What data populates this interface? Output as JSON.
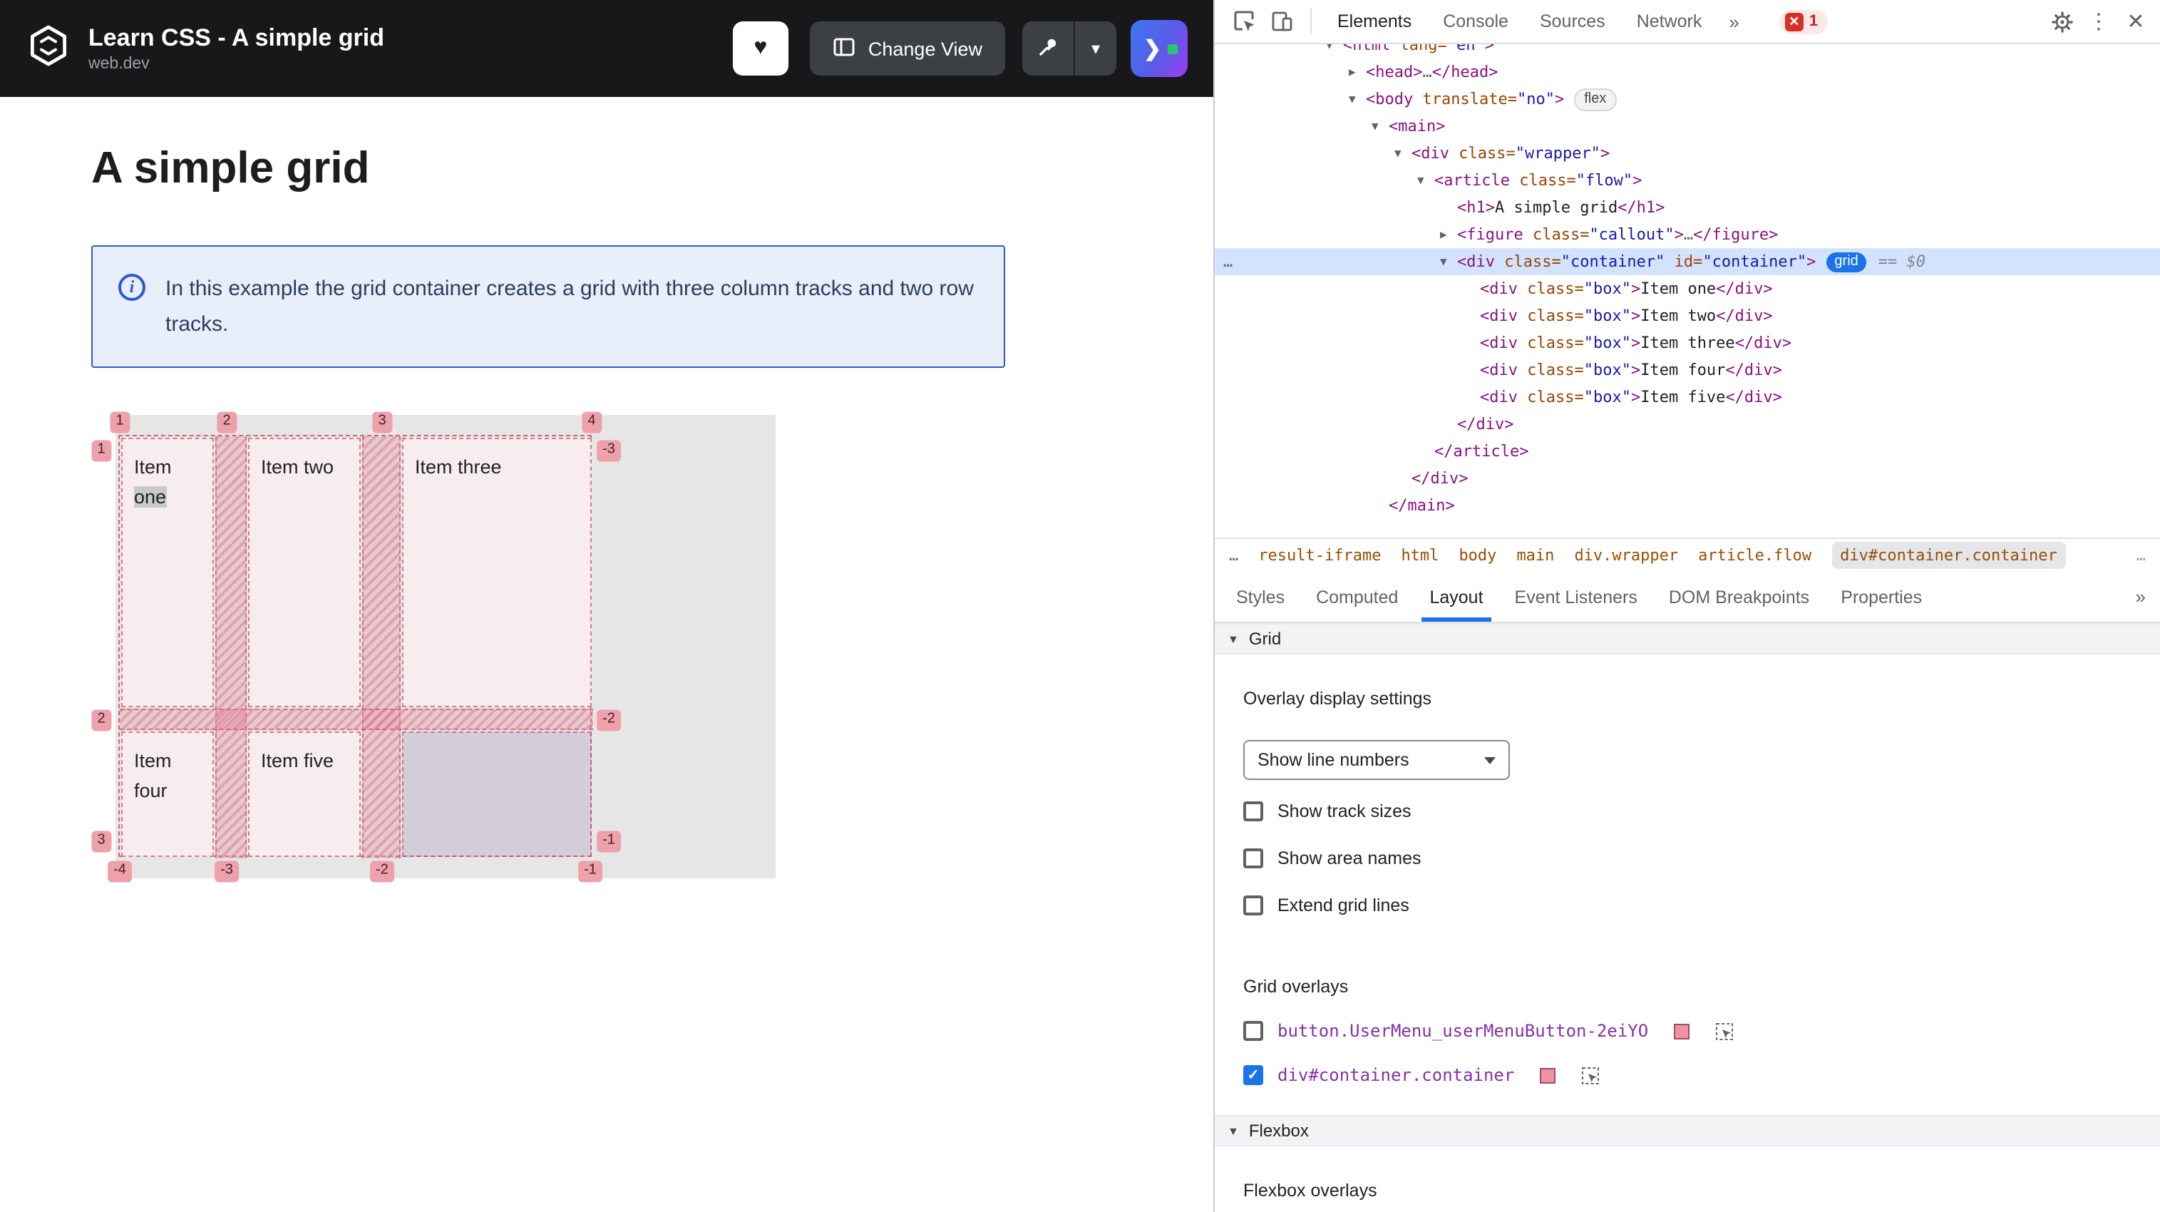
{
  "colors": {
    "accent_blue": "#1a73e8",
    "error_red": "#d93025",
    "overlay_pink": "#ee93a2",
    "callout_blue": "#2a5bd7",
    "header_bg": "#18181b",
    "selected_row_blue": "#d4e3fd"
  },
  "icons": {
    "heart": "♥",
    "chevron_down": "▾",
    "triangle_down": "▼",
    "triangle_right": "▶",
    "more_vertical": "⋮",
    "close": "✕",
    "overflow_chevrons": "»",
    "ellipsis": "…",
    "check": "✓",
    "info": "i",
    "error_x": "✕",
    "launch_chevron": "❯"
  },
  "header": {
    "title": "Learn CSS - A simple grid",
    "subtitle": "web.dev",
    "change_view_label": "Change View"
  },
  "page": {
    "heading": "A simple grid",
    "callout": {
      "text": "In this example the grid container creates a grid with three column tracks and two row tracks."
    },
    "grid_demo": {
      "items": [
        "Item one",
        "Item two",
        "Item three",
        "Item four",
        "Item five"
      ],
      "item1_line1": "Item",
      "item1_line2": "one",
      "item2": "Item two",
      "item3": "Item three",
      "item4_line1": "Item",
      "item4_line2": "four",
      "item5": "Item five",
      "line_labels": {
        "top": [
          "1",
          "2",
          "3",
          "4"
        ],
        "right": [
          "-3",
          "-2",
          "-1"
        ],
        "left": [
          "1",
          "2",
          "3"
        ],
        "bottom": [
          "-4",
          "-3",
          "-2",
          "-1"
        ]
      }
    }
  },
  "devtools": {
    "tabs": [
      {
        "label": "Elements",
        "active": true
      },
      {
        "label": "Console",
        "active": false
      },
      {
        "label": "Sources",
        "active": false
      },
      {
        "label": "Network",
        "active": false
      }
    ],
    "error_count": "1",
    "tree": [
      {
        "i": 0,
        "a": "o",
        "tk": [
          [
            "g",
            "<html"
          ],
          [
            "a",
            " lang="
          ],
          [
            "v",
            "\"en\""
          ],
          [
            "g",
            ">"
          ]
        ]
      },
      {
        "i": 1,
        "a": "c",
        "tk": [
          [
            "g",
            "<head>"
          ],
          [
            "d",
            "…"
          ],
          [
            "g",
            "</head>"
          ]
        ]
      },
      {
        "i": 1,
        "a": "o",
        "badge": "flex",
        "tk": [
          [
            "g",
            "<body"
          ],
          [
            "a",
            " translate="
          ],
          [
            "v",
            "\"no\""
          ],
          [
            "g",
            ">"
          ]
        ]
      },
      {
        "i": 2,
        "a": "o",
        "tk": [
          [
            "g",
            "<main>"
          ]
        ]
      },
      {
        "i": 3,
        "a": "o",
        "tk": [
          [
            "g",
            "<div"
          ],
          [
            "a",
            " class="
          ],
          [
            "v",
            "\"wrapper\""
          ],
          [
            "g",
            ">"
          ]
        ]
      },
      {
        "i": 4,
        "a": "o",
        "tk": [
          [
            "g",
            "<article"
          ],
          [
            "a",
            " class="
          ],
          [
            "v",
            "\"flow\""
          ],
          [
            "g",
            ">"
          ]
        ]
      },
      {
        "i": 5,
        "tk": [
          [
            "g",
            "<h1>"
          ],
          [
            "t",
            "A simple grid"
          ],
          [
            "g",
            "</h1>"
          ]
        ]
      },
      {
        "i": 5,
        "a": "c",
        "tk": [
          [
            "g",
            "<figure"
          ],
          [
            "a",
            " class="
          ],
          [
            "v",
            "\"callout\""
          ],
          [
            "g",
            ">"
          ],
          [
            "d",
            "…"
          ],
          [
            "g",
            "</figure>"
          ]
        ]
      },
      {
        "i": 5,
        "a": "o",
        "sel": true,
        "gutter": true,
        "badge": "grid",
        "suffix": "== $0",
        "tk": [
          [
            "g",
            "<div"
          ],
          [
            "a",
            " class="
          ],
          [
            "v",
            "\"container\""
          ],
          [
            "a",
            " id="
          ],
          [
            "v",
            "\"container\""
          ],
          [
            "g",
            ">"
          ]
        ]
      },
      {
        "i": 6,
        "tk": [
          [
            "g",
            "<div"
          ],
          [
            "a",
            " class="
          ],
          [
            "v",
            "\"box\""
          ],
          [
            "g",
            ">"
          ],
          [
            "t",
            "Item one"
          ],
          [
            "g",
            "</div>"
          ]
        ]
      },
      {
        "i": 6,
        "tk": [
          [
            "g",
            "<div"
          ],
          [
            "a",
            " class="
          ],
          [
            "v",
            "\"box\""
          ],
          [
            "g",
            ">"
          ],
          [
            "t",
            "Item two"
          ],
          [
            "g",
            "</div>"
          ]
        ]
      },
      {
        "i": 6,
        "tk": [
          [
            "g",
            "<div"
          ],
          [
            "a",
            " class="
          ],
          [
            "v",
            "\"box\""
          ],
          [
            "g",
            ">"
          ],
          [
            "t",
            "Item three"
          ],
          [
            "g",
            "</div>"
          ]
        ]
      },
      {
        "i": 6,
        "tk": [
          [
            "g",
            "<div"
          ],
          [
            "a",
            " class="
          ],
          [
            "v",
            "\"box\""
          ],
          [
            "g",
            ">"
          ],
          [
            "t",
            "Item four"
          ],
          [
            "g",
            "</div>"
          ]
        ]
      },
      {
        "i": 6,
        "tk": [
          [
            "g",
            "<div"
          ],
          [
            "a",
            " class="
          ],
          [
            "v",
            "\"box\""
          ],
          [
            "g",
            ">"
          ],
          [
            "t",
            "Item five"
          ],
          [
            "g",
            "</div>"
          ]
        ]
      },
      {
        "i": 5,
        "tk": [
          [
            "g",
            "</div>"
          ]
        ]
      },
      {
        "i": 4,
        "tk": [
          [
            "g",
            "</article>"
          ]
        ]
      },
      {
        "i": 3,
        "tk": [
          [
            "g",
            "</div>"
          ]
        ]
      },
      {
        "i": 2,
        "tk": [
          [
            "g",
            "</main>"
          ]
        ]
      }
    ],
    "breadcrumbs": [
      {
        "label": "result-iframe",
        "active": false
      },
      {
        "label": "html",
        "active": false
      },
      {
        "label": "body",
        "active": false
      },
      {
        "label": "main",
        "active": false
      },
      {
        "label": "div.wrapper",
        "active": false
      },
      {
        "label": "article.flow",
        "active": false
      },
      {
        "label": "div#container.container",
        "active": true
      }
    ],
    "panel_tabs": [
      {
        "label": "Styles",
        "active": false
      },
      {
        "label": "Computed",
        "active": false
      },
      {
        "label": "Layout",
        "active": true
      },
      {
        "label": "Event Listeners",
        "active": false
      },
      {
        "label": "DOM Breakpoints",
        "active": false
      },
      {
        "label": "Properties",
        "active": false
      }
    ],
    "layout_panel": {
      "grid_section_label": "Grid",
      "overlay_settings_label": "Overlay display settings",
      "dropdown_value": "Show line numbers",
      "settings_checkboxes": [
        {
          "label": "Show track sizes",
          "checked": false
        },
        {
          "label": "Show area names",
          "checked": false
        },
        {
          "label": "Extend grid lines",
          "checked": false
        }
      ],
      "grid_overlays_label": "Grid overlays",
      "overlay_rows": [
        {
          "label": "button.UserMenu_userMenuButton-2eiYO",
          "checked": false
        },
        {
          "label": "div#container.container",
          "checked": true
        }
      ],
      "flexbox_section_label": "Flexbox",
      "flexbox_overlays_label": "Flexbox overlays"
    }
  }
}
